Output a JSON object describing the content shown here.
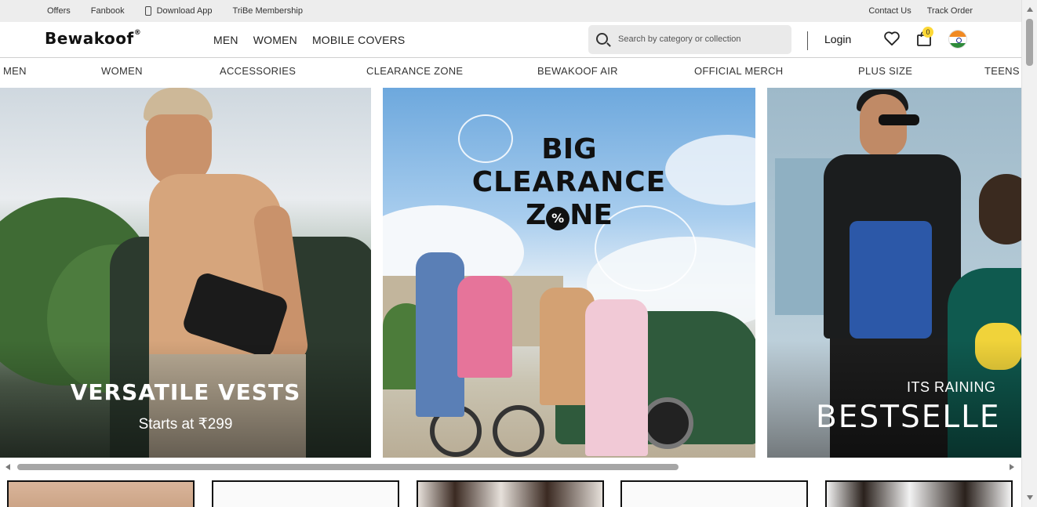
{
  "topbar": {
    "left_links": [
      "Offers",
      "Fanbook",
      "Download App",
      "TriBe Membership"
    ],
    "right_links": [
      "Contact Us",
      "Track Order"
    ]
  },
  "header": {
    "logo": "Bewakoof",
    "logo_mark": "®",
    "nav": [
      "MEN",
      "WOMEN",
      "MOBILE COVERS"
    ],
    "search_placeholder": "Search by category or collection",
    "login_label": "Login",
    "cart_count": "0",
    "icons": [
      "search-icon",
      "heart-icon",
      "bag-icon",
      "india-flag-icon"
    ]
  },
  "category_nav": [
    "MEN",
    "WOMEN",
    "ACCESSORIES",
    "CLEARANCE ZONE",
    "BEWAKOOF AIR",
    "OFFICIAL MERCH",
    "PLUS SIZE",
    "TEENS"
  ],
  "banners": [
    {
      "title": "VERSATILE VESTS",
      "subtitle": "Starts at ₹299"
    },
    {
      "title_lines": [
        "BIG",
        "CLEARANCE",
        "Z",
        "NE"
      ],
      "badge": "%"
    },
    {
      "subtitle": "ITS RAINING",
      "title": "BESTSELLE"
    }
  ],
  "colors": {
    "topbar_bg": "#ededed",
    "search_bg": "#eaeaea",
    "badge": "#fdd835",
    "scroll_thumb": "#a6a6a6"
  }
}
